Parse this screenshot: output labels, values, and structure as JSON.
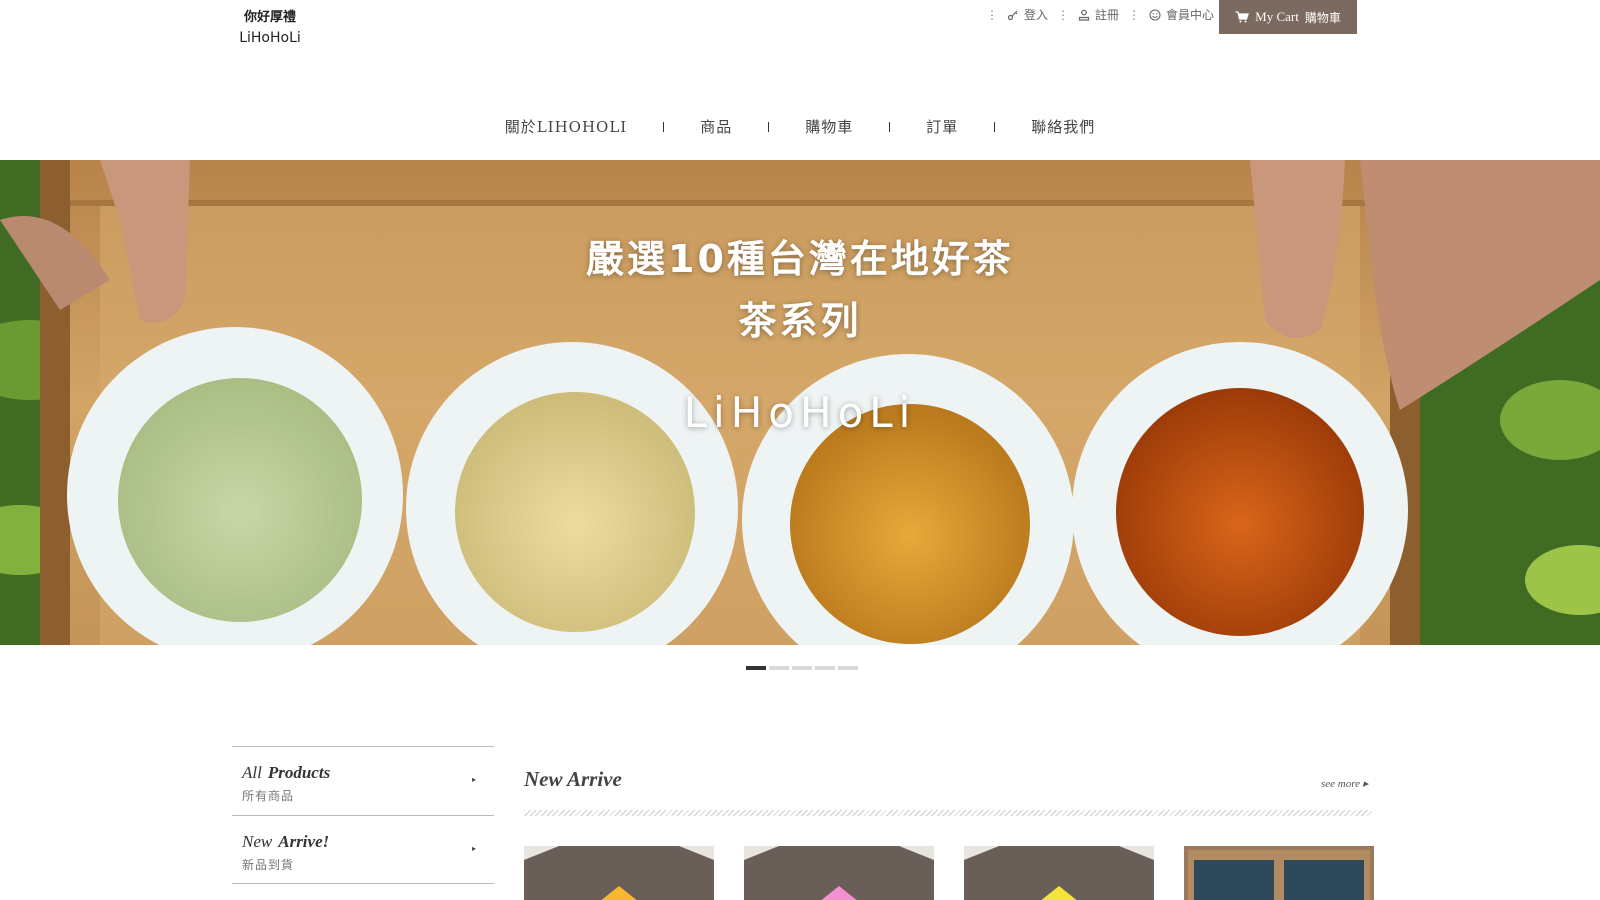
{
  "logo": {
    "cn": "你好厚禮",
    "en": "LiHoHoLi"
  },
  "top_links": {
    "login": "登入",
    "register": "註冊",
    "member": "會員中心"
  },
  "cart": {
    "my_cart": "My Cart",
    "label": "購物車"
  },
  "nav": [
    "關於LIHOHOLI",
    "商品",
    "購物車",
    "訂單",
    "聯絡我們"
  ],
  "hero": {
    "line1": "嚴選10種台灣在地好茶",
    "line2": "茶系列",
    "brand": "LiHoHoLi",
    "slide_count": 5,
    "active_slide": 1
  },
  "side_menu": [
    {
      "en_prefix": "All",
      "en_bold": "Products",
      "cn": "所有商品"
    },
    {
      "en_prefix": "New",
      "en_bold": "Arrive!",
      "cn": "新品到貨"
    }
  ],
  "new_arrive": {
    "title": "New Arrive",
    "see_more": "see more ▸"
  },
  "colors": {
    "cart_bg": "#7b6a5f",
    "product_accents": [
      "#f7b733",
      "#f48fd0",
      "#f5e43a",
      "#2e4a5a"
    ]
  },
  "icons": {
    "login": "key-icon",
    "register": "user-icon",
    "member": "smile-icon",
    "cart": "cart-icon"
  }
}
